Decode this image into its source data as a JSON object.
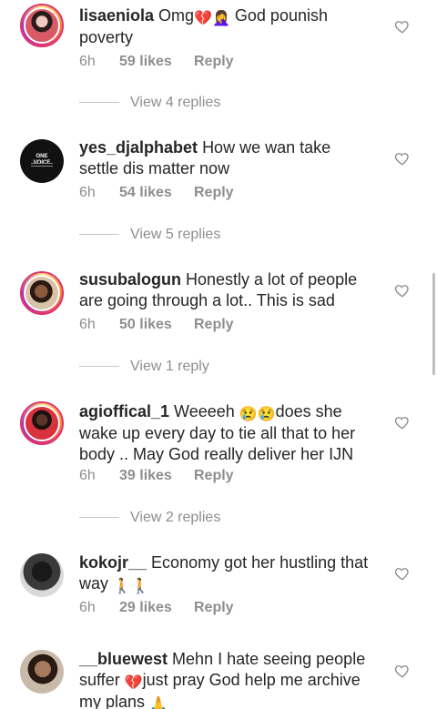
{
  "comments": [
    {
      "username": "lisaeniola",
      "text_a": "Omg",
      "emoji_a": "💔",
      "emoji_b": "🤦‍♀️",
      "text_b": " God pounish poverty",
      "time": "6h",
      "likes": "59 likes",
      "reply": "Reply",
      "view_replies": "View 4 replies"
    },
    {
      "username": "yes_djalphabet",
      "text": "How we wan take settle dis matter now",
      "avatar_text": "ONE VOICE",
      "time": "6h",
      "likes": "54 likes",
      "reply": "Reply",
      "view_replies": "View 5 replies"
    },
    {
      "username": "susubalogun",
      "text": "Honestly a lot of people are going through a lot.. This is sad",
      "time": "6h",
      "likes": "50 likes",
      "reply": "Reply",
      "view_replies": "View 1 reply"
    },
    {
      "username": "agioffical_1",
      "text_a": "Weeeeh ",
      "emoji_a": "😢😢",
      "text_b": "does she wake up every day to tie all that to her body .. May God  really deliver her IJN",
      "time": "6h",
      "likes": "39 likes",
      "reply": "Reply",
      "view_replies": "View 2 replies"
    },
    {
      "username": "kokojr__",
      "text": "Economy got her hustling that way ",
      "emoji_a": "🚶🚶",
      "time": "6h",
      "likes": "29 likes",
      "reply": "Reply"
    },
    {
      "username": "__bluewest",
      "text_a": "Mehn I hate seeing people suffer ",
      "emoji_a": "💔",
      "text_b": "just pray God help me archive my plans ",
      "emoji_b": "🙏"
    }
  ],
  "icons": {
    "like": "heart-outline-icon"
  },
  "colors": {
    "text": "#262626",
    "muted": "#8e8e8e"
  }
}
